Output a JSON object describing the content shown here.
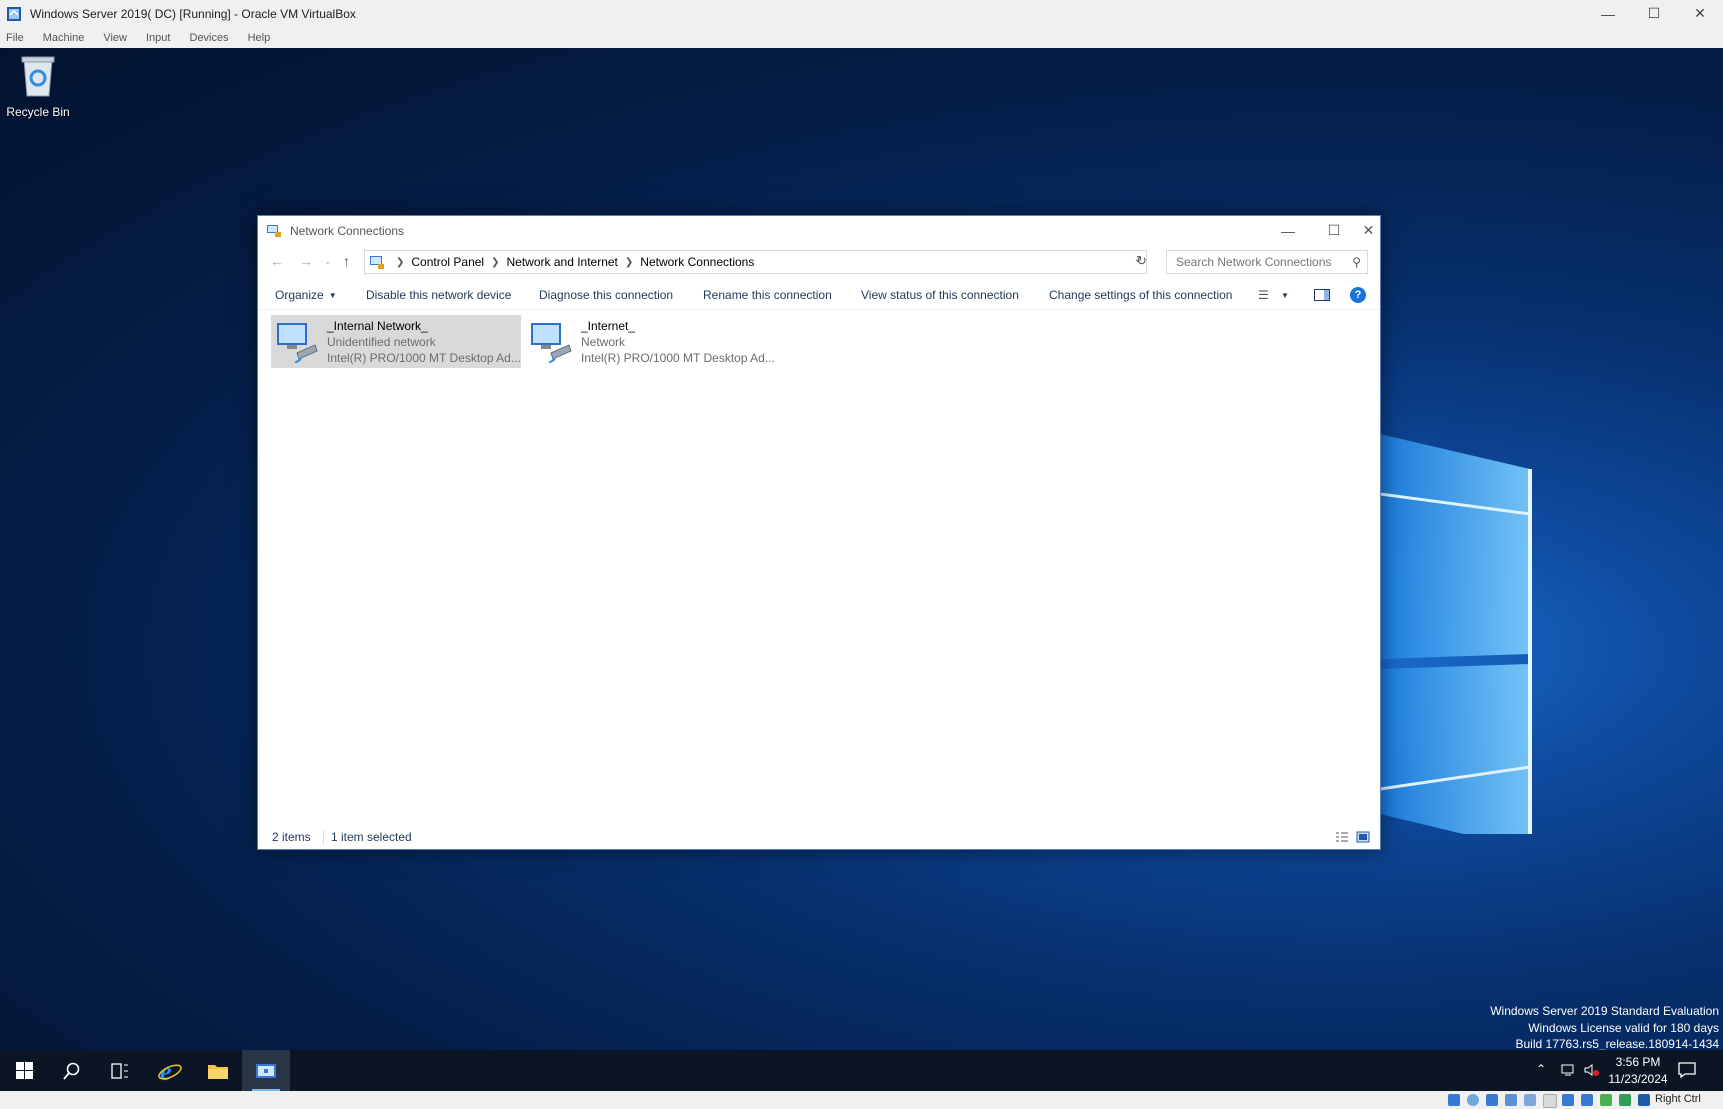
{
  "vbox": {
    "title": "Windows Server 2019( DC) [Running] - Oracle VM VirtualBox",
    "menu": [
      "File",
      "Machine",
      "View",
      "Input",
      "Devices",
      "Help"
    ],
    "host_key": "Right Ctrl"
  },
  "desktop": {
    "recycle_bin": "Recycle Bin",
    "watermark": [
      "Windows Server 2019 Standard Evaluation",
      "Windows License valid for 180 days",
      "Build 17763.rs5_release.180914-1434"
    ]
  },
  "explorer": {
    "title": "Network Connections",
    "breadcrumb": [
      "Control Panel",
      "Network and Internet",
      "Network Connections"
    ],
    "search_placeholder": "Search Network Connections",
    "commands": {
      "organize": "Organize",
      "disable": "Disable this network device",
      "diagnose": "Diagnose this connection",
      "rename": "Rename this connection",
      "view_status": "View status of this connection",
      "change_settings": "Change settings of this connection"
    },
    "items": [
      {
        "name": "_Internal Network_",
        "status": "Unidentified network",
        "adapter": "Intel(R) PRO/1000 MT Desktop Ad...",
        "selected": true
      },
      {
        "name": "_Internet_",
        "status": "Network",
        "adapter": "Intel(R) PRO/1000 MT Desktop Ad...",
        "selected": false
      }
    ],
    "status_bar": {
      "count": "2 items",
      "selection": "1 item selected"
    }
  },
  "taskbar": {
    "time": "3:56 PM",
    "date": "11/23/2024"
  },
  "colors": {
    "accent": "#1a73d9",
    "selection": "#d9d9d9",
    "taskbar": "#0c1524"
  }
}
